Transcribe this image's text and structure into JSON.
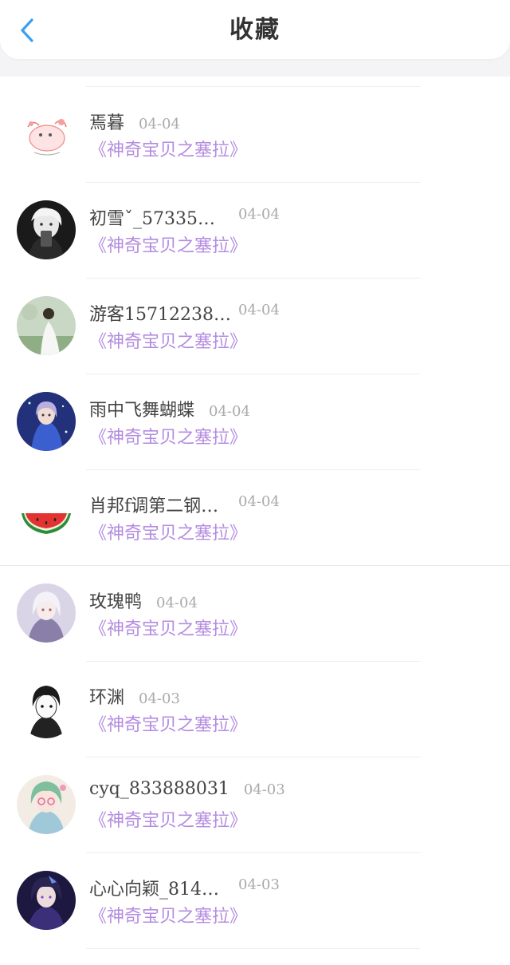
{
  "header": {
    "title": "收藏",
    "back_icon": "chevron-left-icon",
    "accent_color": "#3aa0f0"
  },
  "list": {
    "items": [
      {
        "name": "焉暮",
        "date": "04-04",
        "work": "《神奇宝贝之塞拉》",
        "avatar": "cat-sketch"
      },
      {
        "name": "初雪ˇ_57335…",
        "date": "04-04",
        "work": "《神奇宝贝之塞拉》",
        "avatar": "anime-boy-mono"
      },
      {
        "name": "游客15712238…",
        "date": "04-04",
        "work": "《神奇宝贝之塞拉》",
        "avatar": "girl-white-dress"
      },
      {
        "name": "雨中飞舞蝴蝶",
        "date": "04-04",
        "work": "《神奇宝贝之塞拉》",
        "avatar": "anime-girl-blue"
      },
      {
        "name": "肖邦f调第二钢…",
        "date": "04-04",
        "work": "《神奇宝贝之塞拉》",
        "avatar": "watermelon"
      },
      {
        "name": "玫瑰鸭",
        "date": "04-04",
        "work": "《神奇宝贝之塞拉》",
        "avatar": "anime-girl-white-hair"
      },
      {
        "name": "环渊",
        "date": "04-03",
        "work": "《神奇宝贝之塞拉》",
        "avatar": "anime-boy-sketch"
      },
      {
        "name": "cyq_833888031",
        "date": "04-03",
        "work": "《神奇宝贝之塞拉》",
        "avatar": "anime-girl-glasses"
      },
      {
        "name": "心心向颖_814…",
        "date": "04-03",
        "work": "《神奇宝贝之塞拉》",
        "avatar": "anime-girl-purple"
      }
    ]
  },
  "colors": {
    "name": "#444444",
    "date": "#aaaaaa",
    "work_title": "#b48ce0"
  }
}
